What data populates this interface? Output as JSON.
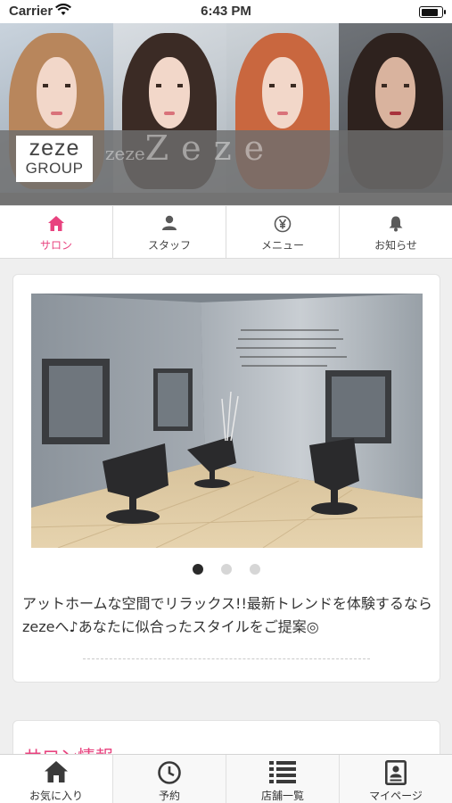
{
  "status_bar": {
    "carrier": "Carrier",
    "time": "6:43 PM",
    "battery_level": 0.9
  },
  "hero": {
    "logo_line1": "zeze",
    "logo_line2": "GROUP",
    "band_text_small": "zeze",
    "band_text_large": "Zeze"
  },
  "top_nav": [
    {
      "label": "サロン",
      "icon": "home-icon",
      "active": true
    },
    {
      "label": "スタッフ",
      "icon": "person-icon",
      "active": false
    },
    {
      "label": "メニュー",
      "icon": "yen-icon",
      "active": false
    },
    {
      "label": "お知らせ",
      "icon": "bell-icon",
      "active": false
    }
  ],
  "carousel": {
    "slide_count": 3,
    "current_slide": 1
  },
  "salon": {
    "description": "アットホームな空間でリラックス!!最新トレンドを体験するならzezeへ♪あなたに似合ったスタイルをご提案◎",
    "info_title": "サロン情報"
  },
  "bottom_nav": [
    {
      "label": "お気に入り",
      "icon": "home-icon"
    },
    {
      "label": "予約",
      "icon": "clock-icon"
    },
    {
      "label": "店舗一覧",
      "icon": "list-icon"
    },
    {
      "label": "マイページ",
      "icon": "id-card-icon"
    }
  ],
  "colors": {
    "accent": "#e8437f",
    "band": "#6e6e6e",
    "background": "#efefef"
  }
}
